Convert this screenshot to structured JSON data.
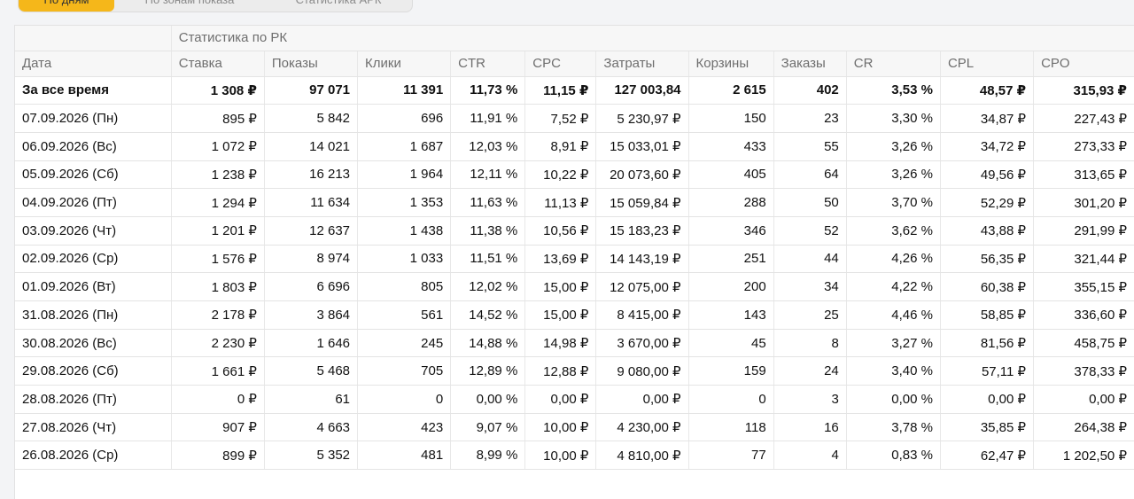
{
  "tabs": [
    {
      "label": "По дням",
      "active": true
    },
    {
      "label": "По зонам показа",
      "active": false
    },
    {
      "label": "Статистика АРК",
      "active": false
    }
  ],
  "table": {
    "group_header": "Статистика по РК",
    "columns": [
      "Дата",
      "Ставка",
      "Показы",
      "Клики",
      "CTR",
      "CPC",
      "Затраты",
      "Корзины",
      "Заказы",
      "CR",
      "CPL",
      "CPO"
    ],
    "rows": [
      [
        "За все время",
        "1 308 ₽",
        "97 071",
        "11 391",
        "11,73 %",
        "11,15 ₽",
        "127 003,84",
        "2 615",
        "402",
        "3,53 %",
        "48,57 ₽",
        "315,93 ₽"
      ],
      [
        "07.09.2026 (Пн)",
        "895 ₽",
        "5 842",
        "696",
        "11,91 %",
        "7,52 ₽",
        "5 230,97 ₽",
        "150",
        "23",
        "3,30 %",
        "34,87 ₽",
        "227,43 ₽"
      ],
      [
        "06.09.2026 (Вс)",
        "1 072 ₽",
        "14 021",
        "1 687",
        "12,03 %",
        "8,91 ₽",
        "15 033,01 ₽",
        "433",
        "55",
        "3,26 %",
        "34,72 ₽",
        "273,33 ₽"
      ],
      [
        "05.09.2026 (Сб)",
        "1 238 ₽",
        "16 213",
        "1 964",
        "12,11 %",
        "10,22 ₽",
        "20 073,60 ₽",
        "405",
        "64",
        "3,26 %",
        "49,56 ₽",
        "313,65 ₽"
      ],
      [
        "04.09.2026 (Пт)",
        "1 294 ₽",
        "11 634",
        "1 353",
        "11,63 %",
        "11,13 ₽",
        "15 059,84 ₽",
        "288",
        "50",
        "3,70 %",
        "52,29 ₽",
        "301,20 ₽"
      ],
      [
        "03.09.2026 (Чт)",
        "1 201 ₽",
        "12 637",
        "1 438",
        "11,38 %",
        "10,56 ₽",
        "15 183,23 ₽",
        "346",
        "52",
        "3,62 %",
        "43,88 ₽",
        "291,99 ₽"
      ],
      [
        "02.09.2026 (Ср)",
        "1 576 ₽",
        "8 974",
        "1 033",
        "11,51 %",
        "13,69 ₽",
        "14 143,19 ₽",
        "251",
        "44",
        "4,26 %",
        "56,35 ₽",
        "321,44 ₽"
      ],
      [
        "01.09.2026 (Вт)",
        "1 803 ₽",
        "6 696",
        "805",
        "12,02 %",
        "15,00 ₽",
        "12 075,00 ₽",
        "200",
        "34",
        "4,22 %",
        "60,38 ₽",
        "355,15 ₽"
      ],
      [
        "31.08.2026 (Пн)",
        "2 178 ₽",
        "3 864",
        "561",
        "14,52 %",
        "15,00 ₽",
        "8 415,00 ₽",
        "143",
        "25",
        "4,46 %",
        "58,85 ₽",
        "336,60 ₽"
      ],
      [
        "30.08.2026 (Вс)",
        "2 230 ₽",
        "1 646",
        "245",
        "14,88 %",
        "14,98 ₽",
        "3 670,00 ₽",
        "45",
        "8",
        "3,27 %",
        "81,56 ₽",
        "458,75 ₽"
      ],
      [
        "29.08.2026 (Сб)",
        "1 661 ₽",
        "5 468",
        "705",
        "12,89 %",
        "12,88 ₽",
        "9 080,00 ₽",
        "159",
        "24",
        "3,40 %",
        "57,11 ₽",
        "378,33 ₽"
      ],
      [
        "28.08.2026 (Пт)",
        "0 ₽",
        "61",
        "0",
        "0,00 %",
        "0,00 ₽",
        "0,00 ₽",
        "0",
        "3",
        "0,00 %",
        "0,00 ₽",
        "0,00 ₽"
      ],
      [
        "27.08.2026 (Чт)",
        "907 ₽",
        "4 663",
        "423",
        "9,07 %",
        "10,00 ₽",
        "4 230,00 ₽",
        "118",
        "16",
        "3,78 %",
        "35,85 ₽",
        "264,38 ₽"
      ],
      [
        "26.08.2026 (Ср)",
        "899 ₽",
        "5 352",
        "481",
        "8,99 %",
        "10,00 ₽",
        "4 810,00 ₽",
        "77",
        "4",
        "0,83 %",
        "62,47 ₽",
        "1 202,50 ₽"
      ]
    ]
  },
  "colors": {
    "active_tab": "#f5b71a",
    "header_bg": "#f7f7f7",
    "header_text": "#6e6e6e"
  }
}
